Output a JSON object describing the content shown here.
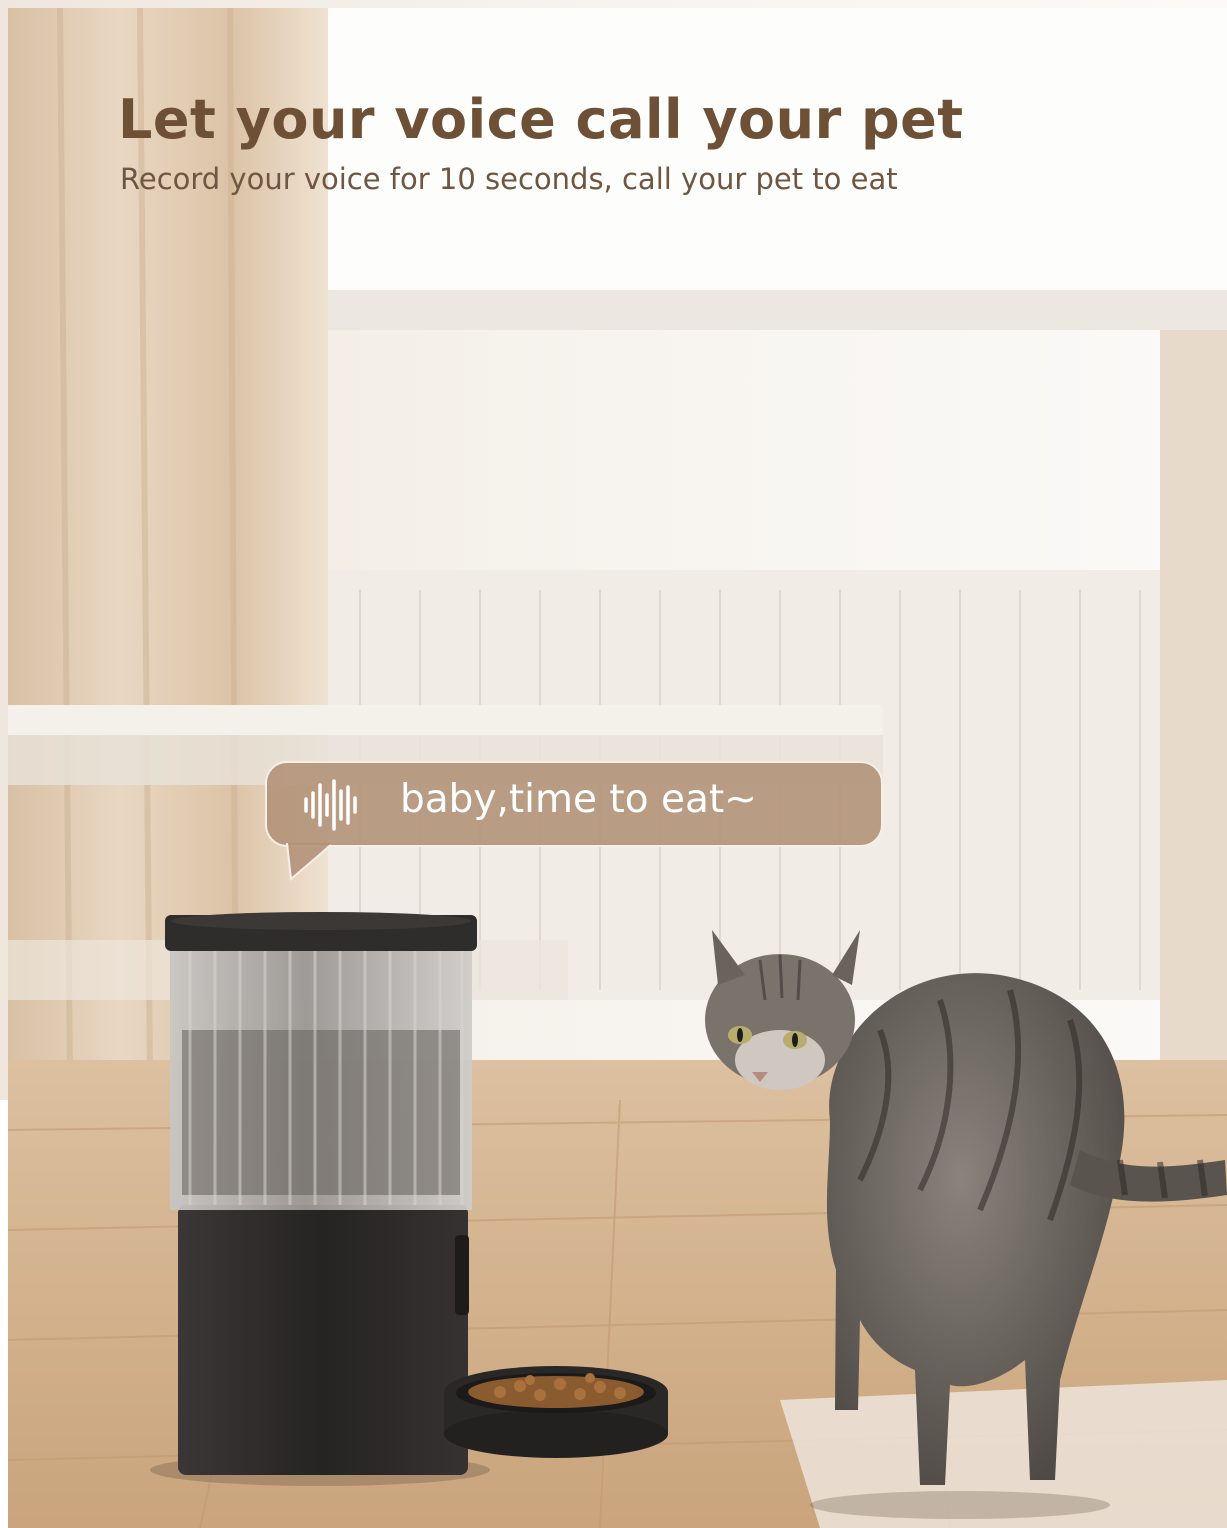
{
  "headline": "Let your voice call your pet",
  "subheadline": "Record your voice for 10 seconds, call your pet to eat",
  "speech_bubble": {
    "icon": "sound-wave-icon",
    "text": "baby,time to eat~"
  },
  "colors": {
    "headline": "#6e5037",
    "subheadline": "#6e5642",
    "bubble_fill": "#b09176",
    "bubble_text": "#ffffff",
    "feeder_body": "#2a2827",
    "cat_fur": "#6d6660"
  }
}
